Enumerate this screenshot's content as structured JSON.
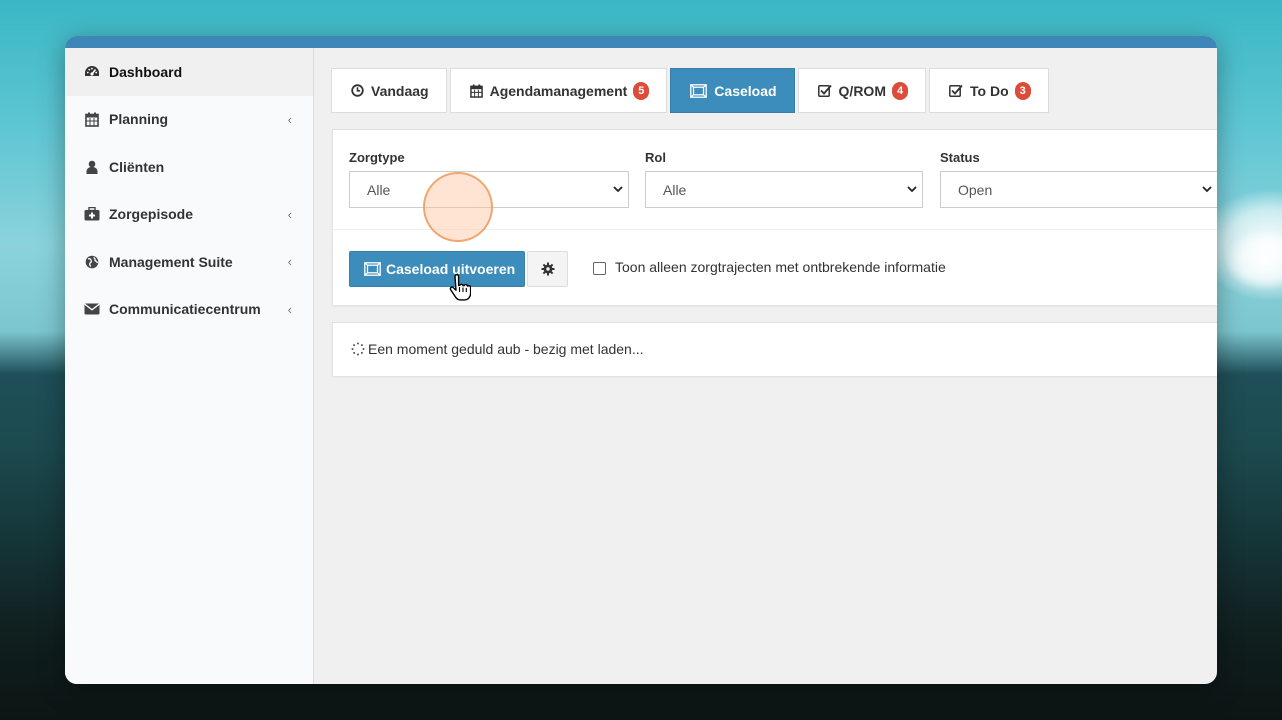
{
  "sidebar": {
    "items": [
      {
        "label": "Dashboard",
        "icon": "dashboard-icon",
        "active": true,
        "has_chevron": false
      },
      {
        "label": "Planning",
        "icon": "calendar-icon",
        "active": false,
        "has_chevron": true
      },
      {
        "label": "Cliënten",
        "icon": "user-icon",
        "active": false,
        "has_chevron": false
      },
      {
        "label": "Zorgepisode",
        "icon": "medkit-icon",
        "active": false,
        "has_chevron": true
      },
      {
        "label": "Management Suite",
        "icon": "globe-icon",
        "active": false,
        "has_chevron": true
      },
      {
        "label": "Communicatiecentrum",
        "icon": "envelope-icon",
        "active": false,
        "has_chevron": true
      }
    ]
  },
  "tabs": [
    {
      "label": "Vandaag",
      "icon": "clock-icon",
      "active": false,
      "badge": ""
    },
    {
      "label": "Agendamanagement",
      "icon": "calendar-icon",
      "active": false,
      "badge": "5"
    },
    {
      "label": "Caseload",
      "icon": "caseload-icon",
      "active": true,
      "badge": ""
    },
    {
      "label": "Q/ROM",
      "icon": "check-square-icon",
      "active": false,
      "badge": "4"
    },
    {
      "label": "To Do",
      "icon": "check-square-icon",
      "active": false,
      "badge": "3"
    }
  ],
  "filters": {
    "zorgtype": {
      "label": "Zorgtype",
      "value": "Alle"
    },
    "rol": {
      "label": "Rol",
      "value": "Alle"
    },
    "status": {
      "label": "Status",
      "value": "Open"
    }
  },
  "actions": {
    "run_label": "Caseload uitvoeren",
    "checkbox_label": "Toon alleen zorgtrajecten met ontbrekende informatie",
    "checkbox_checked": false
  },
  "loading": {
    "text": "Een moment geduld aub - bezig met laden..."
  },
  "colors": {
    "primary": "#3c8dbc",
    "badge": "#dd4b39",
    "topbar": "#3f86b8"
  }
}
